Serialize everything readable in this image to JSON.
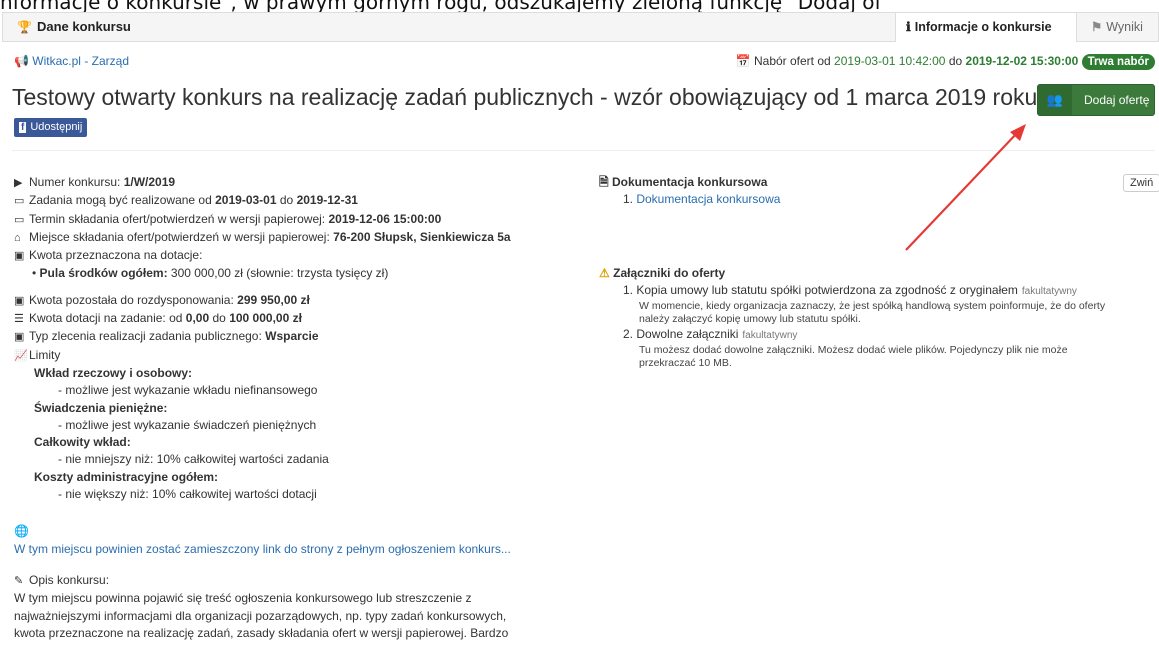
{
  "caption": "nformacje o konkursie\", w prawym górnym rogu, odszukajemy zieloną funkcję \"Dodaj of",
  "header": {
    "title": "Dane konkursu",
    "tabs": [
      {
        "label": "Informacje o konkursie",
        "icon": "info-icon"
      },
      {
        "label": "Wyniki",
        "icon": "flag-icon"
      }
    ]
  },
  "org": {
    "name": "Witkac.pl",
    "sep": " - ",
    "unit": "Zarząd"
  },
  "nabor": {
    "prefix": "Nabór ofert od",
    "from": "2019-03-01 10:42:00",
    "to_word": "do",
    "to": "2019-12-02 15:30:00",
    "status": "Trwa nabór"
  },
  "title": "Testowy otwarty konkurs na realizację zadań publicznych - wzór obowiązujący od 1 marca 2019 roku",
  "share_label": "Udostępnij",
  "add_offer_label": "Dodaj ofertę",
  "details": {
    "numer_label": "Numer konkursu:",
    "numer": "1/W/2019",
    "realizacja_label": "Zadania mogą być realizowane od",
    "realizacja_od": "2019-03-01",
    "realizacja_do_word": "do",
    "realizacja_do": "2019-12-31",
    "termin_label": "Termin składania ofert/potwierdzeń w wersji papierowej:",
    "termin": "2019-12-06 15:00:00",
    "miejsce_label": "Miejsce składania ofert/potwierdzeń w wersji papierowej:",
    "miejsce": "76-200 Słupsk, Sienkiewicza 5a",
    "kwota_label": "Kwota przeznaczona na dotacje:",
    "pula_label": "Pula środków ogółem:",
    "pula": "300 000,00 zł (słownie: trzysta tysięcy zł)",
    "pozostala_label": "Kwota pozostała do rozdysponowania:",
    "pozostala": "299 950,00 zł",
    "dotacja_label": "Kwota dotacji na zadanie: od",
    "dotacja_od": "0,00",
    "dotacja_do_word": "do",
    "dotacja_do": "100 000,00 zł",
    "typ_label": "Typ zlecenia realizacji zadania publicznego:",
    "typ": "Wsparcie",
    "limity_label": "Limity",
    "limity": [
      {
        "head": "Wkład rzeczowy i osobowy:",
        "val": "- możliwe jest wykazanie wkładu niefinansowego"
      },
      {
        "head": "Świadczenia pieniężne:",
        "val": "- możliwe jest wykazanie świadczeń pieniężnych"
      },
      {
        "head": "Całkowity wkład:",
        "val": "- nie mniejszy niż: 10% całkowitej wartości zadania"
      },
      {
        "head": "Koszty administracyjne ogółem:",
        "val": "- nie większy niż: 10% całkowitej wartości dotacji"
      }
    ],
    "link_text": "W tym miejscu powinien zostać zamieszczony link do strony z pełnym ogłoszeniem konkurs...",
    "opis_label": "Opis konkursu:",
    "opis_lines": [
      "W tym miejscu powinna pojawić się treść ogłoszenia konkursowego lub streszczenie z",
      "najważniejszymi informacjami dla organizacji pozarządowych, np. typy zadań konkursowych,",
      "kwota przeznaczone na realizację zadań, zasady składania ofert w wersji papierowej. Bardzo"
    ]
  },
  "docs": {
    "title": "Dokumentacja konkursowa",
    "items": [
      "Dokumentacja konkursowa"
    ],
    "collapse_label": "Zwiń"
  },
  "attachments": {
    "title": "Załączniki do oferty",
    "items": [
      {
        "num": "1.",
        "name": "Kopia umowy lub statutu spółki potwierdzona za zgodność z oryginałem",
        "tag": "fakultatywny",
        "desc1": "W momencie, kiedy organizacja zaznaczy, że jest spółką handlową system poinformuje, że do oferty",
        "desc2": "należy załączyć kopię umowy lub statutu spółki."
      },
      {
        "num": "2.",
        "name": "Dowolne załączniki",
        "tag": "fakultatywny",
        "desc1": "Tu możesz dodać dowolne załączniki. Możesz dodać wiele plików. Pojedynczy plik nie może",
        "desc2": "przekraczać 10 MB."
      }
    ]
  },
  "colors": {
    "green": "#2e7d32",
    "link": "#2a6db0",
    "arrow": "#e53935"
  }
}
